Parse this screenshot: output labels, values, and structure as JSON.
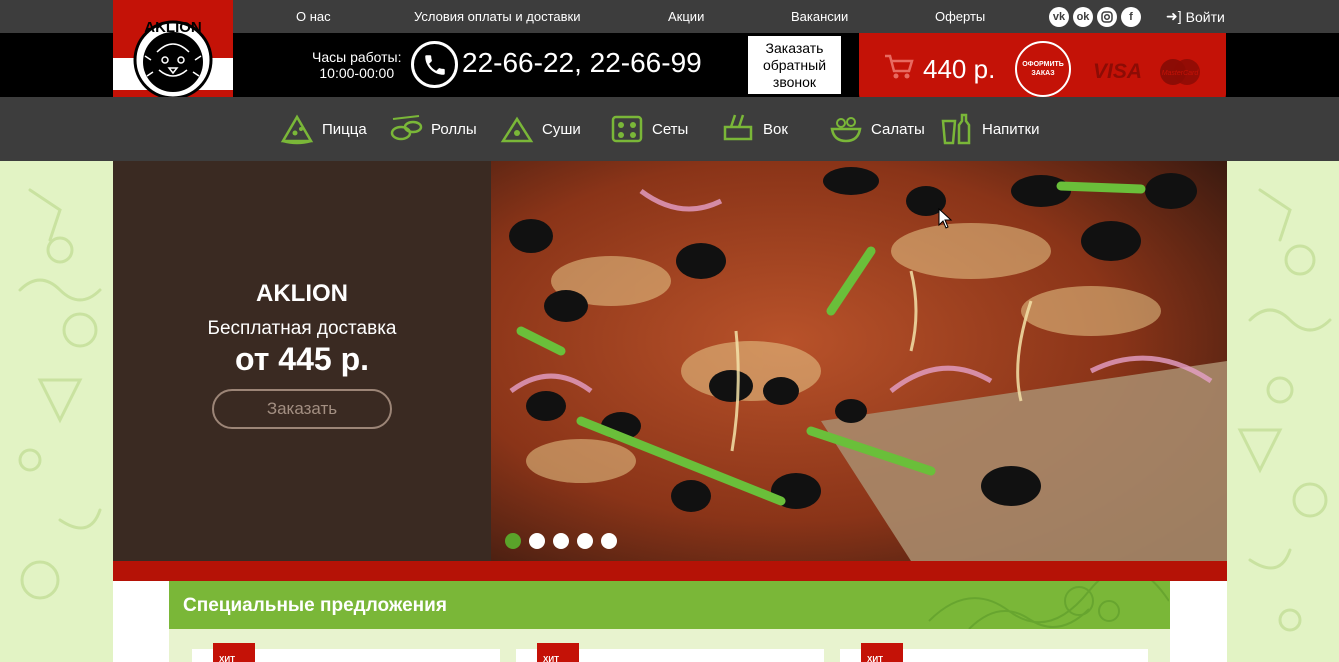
{
  "topnav": {
    "items": [
      "О нас",
      "Условия оплаты и доставки",
      "Акции",
      "Вакансии",
      "Оферты"
    ],
    "socials": [
      "vk-icon",
      "odnoklassniki-icon",
      "instagram-icon",
      "facebook-icon"
    ],
    "login": "Войти"
  },
  "logo": {
    "text": "AKLION"
  },
  "header": {
    "hours_label": "Часы работы:",
    "hours_value": "10:00-00:00",
    "phones": "22-66-22, 22-66-99",
    "callback": [
      "Заказать",
      "обратный",
      "звонок"
    ],
    "cart_sum": "440 р.",
    "order_button": [
      "ОФОРМИТЬ",
      "ЗАКАЗ"
    ],
    "visa": "VISA",
    "mastercard": "MasterCard"
  },
  "categories": [
    {
      "label": "Пицца",
      "icon": "pizza-icon"
    },
    {
      "label": "Роллы",
      "icon": "rolls-icon"
    },
    {
      "label": "Суши",
      "icon": "sushi-icon"
    },
    {
      "label": "Сеты",
      "icon": "sets-icon"
    },
    {
      "label": "Вок",
      "icon": "wok-icon"
    },
    {
      "label": "Салаты",
      "icon": "salad-icon"
    },
    {
      "label": "Напитки",
      "icon": "drinks-icon"
    }
  ],
  "hero": {
    "brand": "AKLION",
    "subtitle": "Бесплатная доставка",
    "price": "от 445 р.",
    "button": "Заказать",
    "slides_total": 5,
    "active_slide": 1
  },
  "special": {
    "title": "Специальные предложения",
    "card_tag": "ХИТ"
  },
  "colors": {
    "dark": "#3d3d3d",
    "red": "#c41207",
    "green": "#7ab738",
    "background": "#e2f3c4"
  }
}
